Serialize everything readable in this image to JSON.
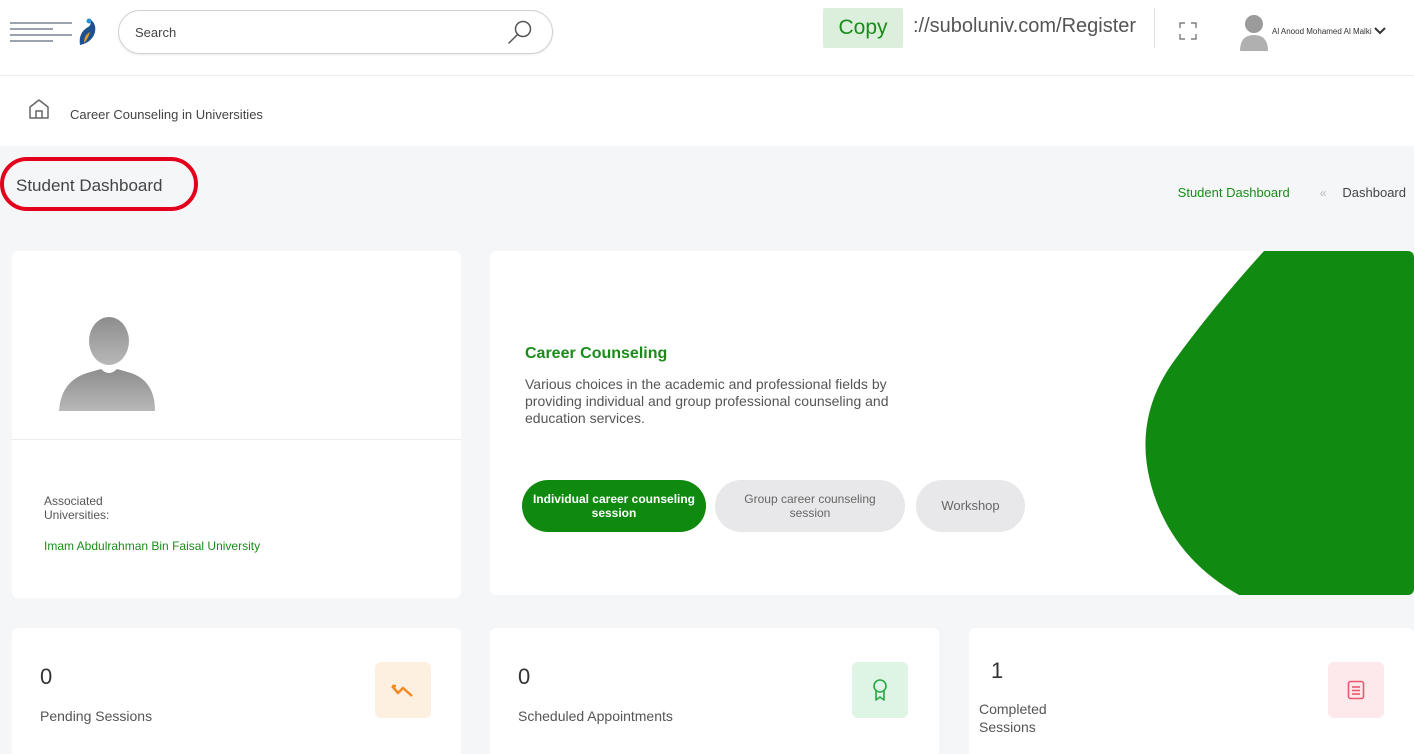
{
  "header": {
    "search_placeholder": "Search",
    "copy_label": "Copy",
    "register_url": "://suboluniv.com/Register",
    "user_name": "Al Anood Mohamed Al Malki"
  },
  "breadcrumb": {
    "text": "Career Counseling in Universities"
  },
  "page": {
    "title": "Student Dashboard",
    "trail_active": "Student Dashboard",
    "trail_separator": "«",
    "trail_home": "Dashboard"
  },
  "profile": {
    "assoc_label": "Associated Universities:",
    "assoc_value": "Imam Abdulrahman Bin Faisal University"
  },
  "counseling": {
    "title": "Career Counseling",
    "description": "Various choices in the academic and professional fields by providing individual and group professional counseling and education services.",
    "buttons": [
      {
        "label": "Individual career counseling session"
      },
      {
        "label": "Group career counseling session"
      },
      {
        "label": "Workshop"
      }
    ]
  },
  "stats": [
    {
      "value": "0",
      "label": "Pending Sessions",
      "icon": "trend-icon",
      "color": "#f08a24"
    },
    {
      "value": "0",
      "label": "Scheduled Appointments",
      "icon": "award-icon",
      "color": "#28a745"
    },
    {
      "value": "1",
      "label": "Completed Sessions",
      "icon": "document-icon",
      "color": "#e85a6f"
    }
  ],
  "colors": {
    "accent": "#1a8c1a",
    "highlight_ring": "#e4001c"
  }
}
